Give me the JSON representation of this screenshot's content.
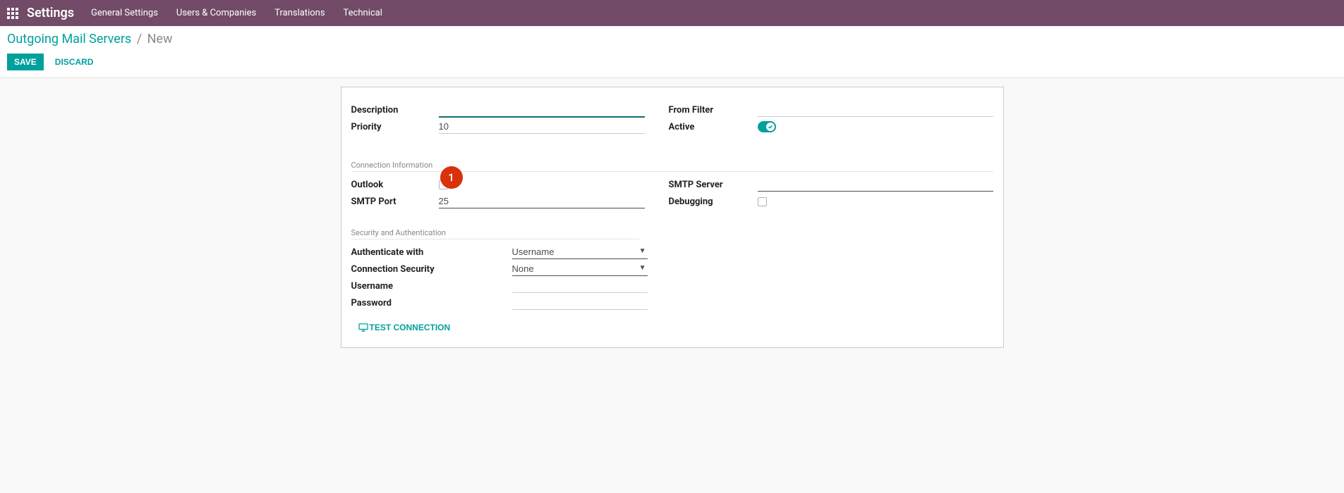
{
  "navbar": {
    "brand": "Settings",
    "items": [
      "General Settings",
      "Users & Companies",
      "Translations",
      "Technical"
    ]
  },
  "breadcrumb": {
    "link_text": "Outgoing Mail Servers",
    "current": "New"
  },
  "actions": {
    "save": "Save",
    "discard": "Discard"
  },
  "form": {
    "labels": {
      "description": "Description",
      "priority": "Priority",
      "from_filter": "From Filter",
      "active": "Active",
      "outlook": "Outlook",
      "smtp_port": "SMTP Port",
      "smtp_server": "SMTP Server",
      "debugging": "Debugging",
      "auth_with": "Authenticate with",
      "conn_security": "Connection Security",
      "username": "Username",
      "password": "Password"
    },
    "section_headers": {
      "connection": "Connection Information",
      "security": "Security and Authentication"
    },
    "values": {
      "description": "",
      "priority": "10",
      "from_filter": "",
      "smtp_port": "25",
      "smtp_server": "",
      "auth_with": "Username",
      "conn_security": "None",
      "username": "",
      "password": ""
    },
    "test_connection": "Test Connection"
  },
  "marker": {
    "label": "1"
  }
}
